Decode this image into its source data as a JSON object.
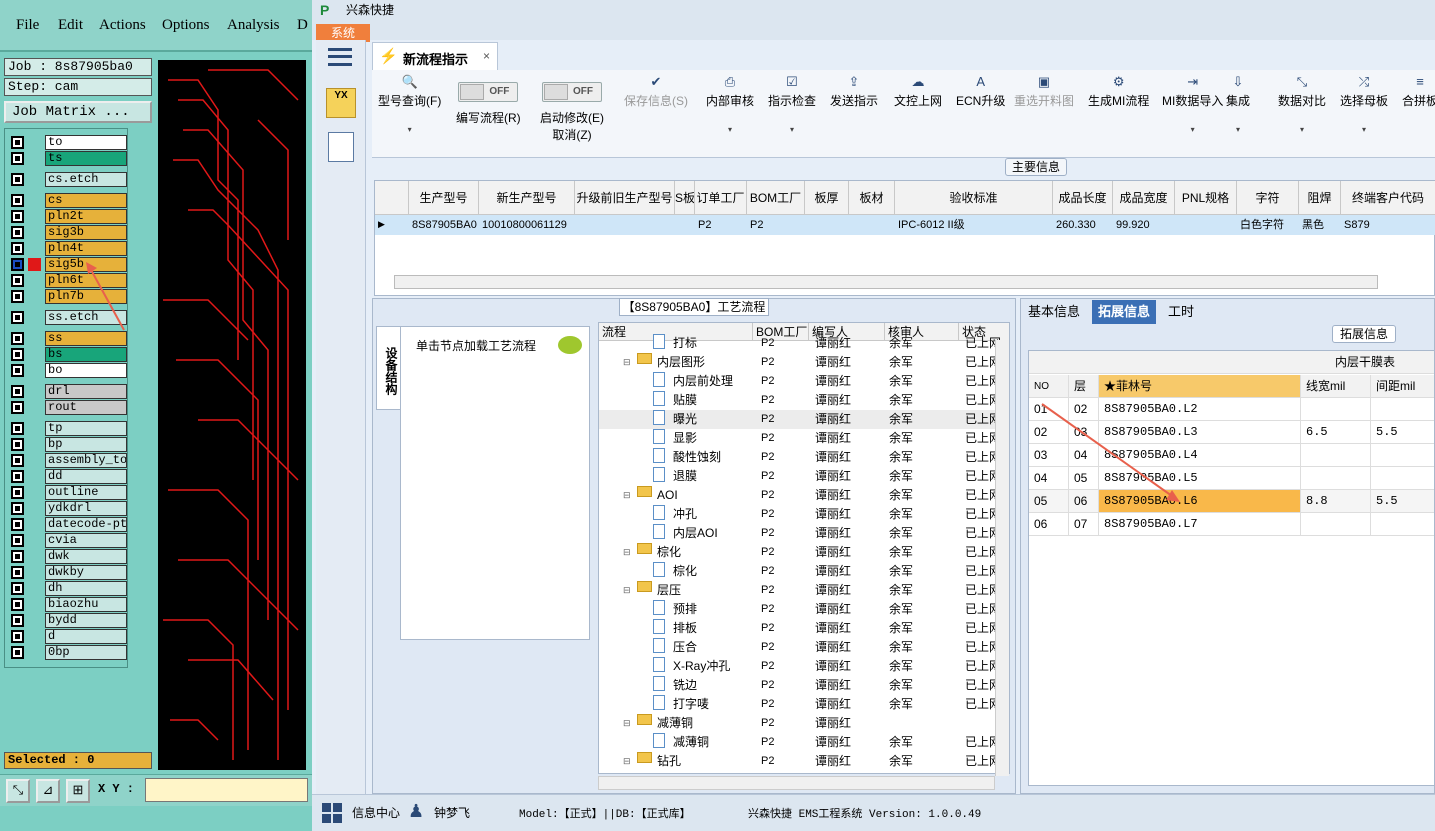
{
  "cam": {
    "menu": [
      "File",
      "Edit",
      "Actions",
      "Options",
      "Analysis",
      "D"
    ],
    "job": "Job : 8s87905ba0",
    "step": "Step: cam",
    "job_matrix": "Job Matrix ...",
    "layers": [
      {
        "name": "to",
        "color": "#ffffff",
        "mark": ""
      },
      {
        "name": "ts",
        "color": "#18a57a",
        "mark": ""
      },
      {
        "name": "cs.etch",
        "color": "#c8e6e2",
        "mark": ""
      },
      {
        "name": "cs",
        "color": "#e6b13a",
        "mark": ""
      },
      {
        "name": "pln2t",
        "color": "#e6b13a",
        "mark": ""
      },
      {
        "name": "sig3b",
        "color": "#e6b13a",
        "mark": ""
      },
      {
        "name": "pln4t",
        "color": "#e6b13a",
        "mark": ""
      },
      {
        "name": "sig5b",
        "color": "#e6b13a",
        "mark": "red"
      },
      {
        "name": "pln6t",
        "color": "#e6b13a",
        "mark": ""
      },
      {
        "name": "pln7b",
        "color": "#e6b13a",
        "mark": ""
      },
      {
        "name": "ss.etch",
        "color": "#c8e6e2",
        "mark": ""
      },
      {
        "name": "ss",
        "color": "#e6b13a",
        "mark": ""
      },
      {
        "name": "bs",
        "color": "#18a57a",
        "mark": ""
      },
      {
        "name": "bo",
        "color": "#ffffff",
        "mark": ""
      },
      {
        "name": "drl",
        "color": "#c8c8c8",
        "mark": ""
      },
      {
        "name": "rout",
        "color": "#c8c8c8",
        "mark": ""
      },
      {
        "name": "tp",
        "color": "#c8e6e2",
        "mark": ""
      },
      {
        "name": "bp",
        "color": "#c8e6e2",
        "mark": ""
      },
      {
        "name": "assembly_top",
        "color": "#c8e6e2",
        "mark": ""
      },
      {
        "name": "dd",
        "color": "#c8e6e2",
        "mark": ""
      },
      {
        "name": "outline",
        "color": "#c8e6e2",
        "mark": ""
      },
      {
        "name": "ydkdrl",
        "color": "#c8e6e2",
        "mark": ""
      },
      {
        "name": "datecode-ptc",
        "color": "#c8e6e2",
        "mark": ""
      },
      {
        "name": "cvia",
        "color": "#c8e6e2",
        "mark": ""
      },
      {
        "name": "dwk",
        "color": "#c8e6e2",
        "mark": ""
      },
      {
        "name": "dwkby",
        "color": "#c8e6e2",
        "mark": ""
      },
      {
        "name": "dh",
        "color": "#c8e6e2",
        "mark": ""
      },
      {
        "name": "biaozhu",
        "color": "#c8e6e2",
        "mark": ""
      },
      {
        "name": "bydd",
        "color": "#c8e6e2",
        "mark": ""
      },
      {
        "name": "d",
        "color": "#c8e6e2",
        "mark": ""
      },
      {
        "name": "0bp",
        "color": "#c8e6e2",
        "mark": ""
      }
    ],
    "selected": "Selected : 0",
    "xy_label": "X Y :"
  },
  "erp": {
    "app_name": "兴森快捷",
    "sys_tab": "系统",
    "doc_tab": "新流程指示",
    "ribbon": [
      {
        "label": "型号查询(F)",
        "icon": "search-icon",
        "disabled": false,
        "dd": true
      },
      {
        "label": "编写流程(R)",
        "icon": "toggle",
        "disabled": false,
        "dd": false
      },
      {
        "label": "启动修改(E)",
        "label2": "取消(Z)",
        "icon": "toggle",
        "disabled": false,
        "dd": false
      },
      {
        "label": "保存信息(S)",
        "icon": "check-icon",
        "disabled": true,
        "dd": false
      },
      {
        "label": "内部审核",
        "icon": "print-icon",
        "disabled": false,
        "dd": true
      },
      {
        "label": "指示检查",
        "icon": "checkbox-icon",
        "disabled": false,
        "dd": true
      },
      {
        "label": "发送指示",
        "icon": "upload-icon",
        "disabled": false,
        "dd": false
      },
      {
        "label": "文控上网",
        "icon": "cloud-upload-icon",
        "disabled": false,
        "dd": false
      },
      {
        "label": "ECN升级",
        "icon": "font-icon",
        "disabled": false,
        "dd": false
      },
      {
        "label": "重选开料图",
        "icon": "image-icon",
        "disabled": true,
        "dd": false
      },
      {
        "label": "生成MI流程",
        "icon": "cogs-icon",
        "disabled": false,
        "dd": false
      },
      {
        "label": "MI数据导入",
        "icon": "import-icon",
        "disabled": false,
        "dd": true
      },
      {
        "label": "集成",
        "icon": "download-icon",
        "disabled": false,
        "dd": true
      },
      {
        "label": "数据对比",
        "icon": "compress-icon",
        "disabled": false,
        "dd": true
      },
      {
        "label": "选择母板",
        "icon": "random-icon",
        "disabled": false,
        "dd": true
      },
      {
        "label": "合拼板",
        "icon": "list-icon",
        "disabled": false,
        "dd": false
      }
    ],
    "toggle_off": "OFF",
    "main_info_label": "主要信息",
    "grid1": {
      "headers": [
        "生产型号",
        "新生产型号",
        "升级前旧生产型号",
        "S板",
        "订单工厂",
        "BOM工厂",
        "板厚",
        "板材",
        "验收标准",
        "成品长度",
        "成品宽度",
        "PNL规格",
        "字符",
        "阻焊",
        "终端客户代码"
      ],
      "row": [
        "8S87905BA0",
        "10010800061129",
        "",
        "",
        "P2",
        "P2",
        "",
        "",
        "IPC-6012 II级",
        "260.330",
        "99.920",
        "",
        "白色字符",
        "黑色",
        "S879"
      ]
    },
    "proc_title": "【8S87905BA0】工艺流程",
    "vtab": "设备结构",
    "hint": "单击节点加载工艺流程",
    "tree_headers": [
      "流程",
      "BOM工厂",
      "编写人",
      "核审人",
      "状态"
    ],
    "tree_rows": [
      {
        "level": 2,
        "type": "file",
        "name": "打标",
        "bom": "P2",
        "writer": "谭丽红",
        "auditor": "余军",
        "status": "已上网"
      },
      {
        "level": 1,
        "type": "folder",
        "name": "内层图形",
        "bom": "P2",
        "writer": "谭丽红",
        "auditor": "余军",
        "status": "已上网"
      },
      {
        "level": 2,
        "type": "file",
        "name": "内层前处理",
        "bom": "P2",
        "writer": "谭丽红",
        "auditor": "余军",
        "status": "已上网"
      },
      {
        "level": 2,
        "type": "file",
        "name": "贴膜",
        "bom": "P2",
        "writer": "谭丽红",
        "auditor": "余军",
        "status": "已上网"
      },
      {
        "level": 2,
        "type": "file",
        "name": "曝光",
        "bom": "P2",
        "writer": "谭丽红",
        "auditor": "余军",
        "status": "已上网",
        "selected": true
      },
      {
        "level": 2,
        "type": "file",
        "name": "显影",
        "bom": "P2",
        "writer": "谭丽红",
        "auditor": "余军",
        "status": "已上网"
      },
      {
        "level": 2,
        "type": "file",
        "name": "酸性蚀刻",
        "bom": "P2",
        "writer": "谭丽红",
        "auditor": "余军",
        "status": "已上网"
      },
      {
        "level": 2,
        "type": "file",
        "name": "退膜",
        "bom": "P2",
        "writer": "谭丽红",
        "auditor": "余军",
        "status": "已上网"
      },
      {
        "level": 1,
        "type": "folder",
        "name": "AOI",
        "bom": "P2",
        "writer": "谭丽红",
        "auditor": "余军",
        "status": "已上网"
      },
      {
        "level": 2,
        "type": "file",
        "name": "冲孔",
        "bom": "P2",
        "writer": "谭丽红",
        "auditor": "余军",
        "status": "已上网"
      },
      {
        "level": 2,
        "type": "file",
        "name": "内层AOI",
        "bom": "P2",
        "writer": "谭丽红",
        "auditor": "余军",
        "status": "已上网"
      },
      {
        "level": 1,
        "type": "folder",
        "name": "棕化",
        "bom": "P2",
        "writer": "谭丽红",
        "auditor": "余军",
        "status": "已上网"
      },
      {
        "level": 2,
        "type": "file",
        "name": "棕化",
        "bom": "P2",
        "writer": "谭丽红",
        "auditor": "余军",
        "status": "已上网"
      },
      {
        "level": 1,
        "type": "folder",
        "name": "层压",
        "bom": "P2",
        "writer": "谭丽红",
        "auditor": "余军",
        "status": "已上网"
      },
      {
        "level": 2,
        "type": "file",
        "name": "预排",
        "bom": "P2",
        "writer": "谭丽红",
        "auditor": "余军",
        "status": "已上网"
      },
      {
        "level": 2,
        "type": "file",
        "name": "排板",
        "bom": "P2",
        "writer": "谭丽红",
        "auditor": "余军",
        "status": "已上网"
      },
      {
        "level": 2,
        "type": "file",
        "name": "压合",
        "bom": "P2",
        "writer": "谭丽红",
        "auditor": "余军",
        "status": "已上网"
      },
      {
        "level": 2,
        "type": "file",
        "name": "X-Ray冲孔",
        "bom": "P2",
        "writer": "谭丽红",
        "auditor": "余军",
        "status": "已上网"
      },
      {
        "level": 2,
        "type": "file",
        "name": "铣边",
        "bom": "P2",
        "writer": "谭丽红",
        "auditor": "余军",
        "status": "已上网"
      },
      {
        "level": 2,
        "type": "file",
        "name": "打字唛",
        "bom": "P2",
        "writer": "谭丽红",
        "auditor": "余军",
        "status": "已上网"
      },
      {
        "level": 1,
        "type": "folder",
        "name": "减薄铜",
        "bom": "P2",
        "writer": "谭丽红",
        "auditor": "",
        "status": ""
      },
      {
        "level": 2,
        "type": "file",
        "name": "减薄铜",
        "bom": "P2",
        "writer": "谭丽红",
        "auditor": "余军",
        "status": "已上网"
      },
      {
        "level": 1,
        "type": "folder",
        "name": "钻孔",
        "bom": "P2",
        "writer": "谭丽红",
        "auditor": "余军",
        "status": "已上网"
      }
    ],
    "right_tabs": [
      "基本信息",
      "拓展信息",
      "工时"
    ],
    "ext_label": "拓展信息",
    "grid2": {
      "group_header": "内层干膜表",
      "headers": [
        "NO",
        "层",
        "★菲林号",
        "线宽mil",
        "间距mil"
      ],
      "rows": [
        {
          "no": "01",
          "layer": "02",
          "film": "8S87905BA0.L2",
          "width": "",
          "space": ""
        },
        {
          "no": "02",
          "layer": "03",
          "film": "8S87905BA0.L3",
          "width": "6.5",
          "space": "5.5"
        },
        {
          "no": "03",
          "layer": "04",
          "film": "8S87905BA0.L4",
          "width": "",
          "space": ""
        },
        {
          "no": "04",
          "layer": "05",
          "film": "8S87905BA0.L5",
          "width": "",
          "space": ""
        },
        {
          "no": "05",
          "layer": "06",
          "film": "8S87905BA0.L6",
          "width": "8.8",
          "space": "5.5",
          "highlight": true
        },
        {
          "no": "06",
          "layer": "07",
          "film": "8S87905BA0.L7",
          "width": "",
          "space": ""
        }
      ]
    },
    "status": {
      "info_center": "信息中心",
      "user": "钟梦飞",
      "model": "Model:【正式】||DB:【正式库】",
      "system": "兴森快捷 EMS工程系统 Version: 1.0.0.49"
    }
  }
}
